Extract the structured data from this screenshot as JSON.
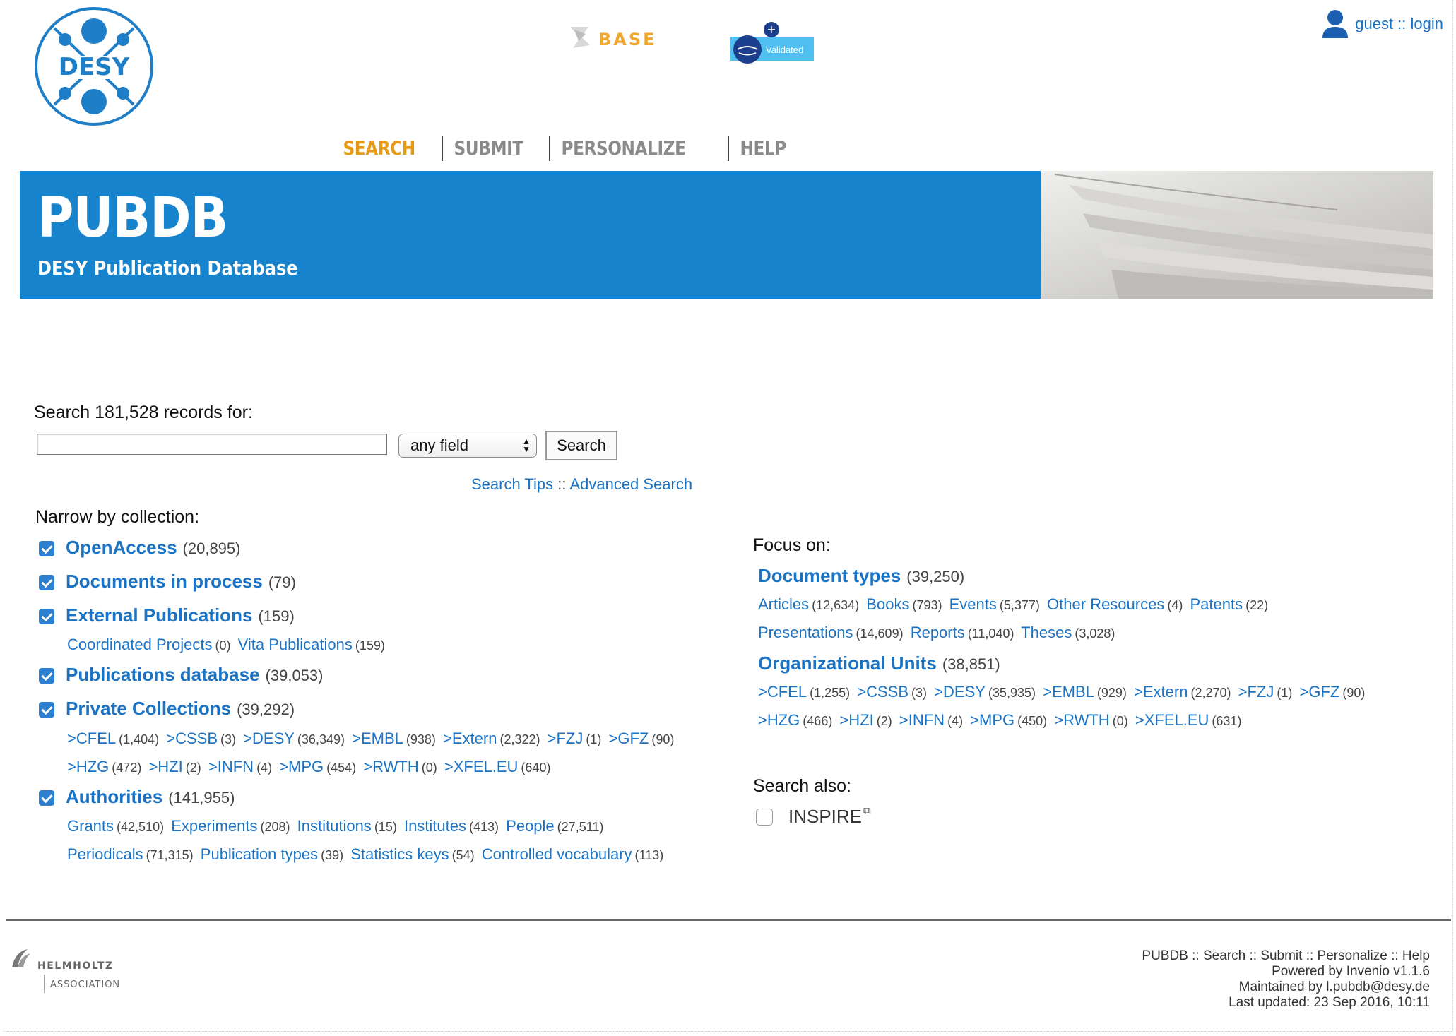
{
  "header": {
    "logo_text": "DESY",
    "base_logo_text": "BASE",
    "validated_text": "Validated",
    "user_label": "guest :: login"
  },
  "nav": {
    "items": [
      "SEARCH",
      "SUBMIT",
      "PERSONALIZE",
      "HELP"
    ],
    "active": "SEARCH"
  },
  "banner": {
    "title": "PUBDB",
    "subtitle": "DESY Publication Database"
  },
  "search": {
    "label": "Search 181,528 records for:",
    "query": "",
    "field_selected": "any field",
    "button": "Search",
    "tips": "Search Tips",
    "tips_sep": "::",
    "advanced": "Advanced Search"
  },
  "narrow": {
    "title": "Narrow by collection:",
    "collections": [
      {
        "name": "OpenAccess",
        "count": "(20,895)",
        "checked": true
      },
      {
        "name": "Documents in process",
        "count": "(79)",
        "checked": true
      },
      {
        "name": "External Publications",
        "count": "(159)",
        "checked": true
      },
      {
        "name": "Publications database",
        "count": "(39,053)",
        "checked": true
      },
      {
        "name": "Private Collections",
        "count": "(39,292)",
        "checked": true
      },
      {
        "name": "Authorities",
        "count": "(141,955)",
        "checked": true
      }
    ],
    "external_sub": [
      {
        "name": "Coordinated Projects",
        "count": "(0)"
      },
      {
        "name": "Vita Publications",
        "count": "(159)"
      }
    ],
    "private_sub_1": [
      {
        "name": ">CFEL",
        "count": "(1,404)"
      },
      {
        "name": ">CSSB",
        "count": "(3)"
      },
      {
        "name": ">DESY",
        "count": "(36,349)"
      },
      {
        "name": ">EMBL",
        "count": "(938)"
      },
      {
        "name": ">Extern",
        "count": "(2,322)"
      },
      {
        "name": ">FZJ",
        "count": "(1)"
      },
      {
        "name": ">GFZ",
        "count": "(90)"
      }
    ],
    "private_sub_2": [
      {
        "name": ">HZG",
        "count": "(472)"
      },
      {
        "name": ">HZI",
        "count": "(2)"
      },
      {
        "name": ">INFN",
        "count": "(4)"
      },
      {
        "name": ">MPG",
        "count": "(454)"
      },
      {
        "name": ">RWTH",
        "count": "(0)"
      },
      {
        "name": ">XFEL.EU",
        "count": "(640)"
      }
    ],
    "auth_sub_1": [
      {
        "name": "Grants",
        "count": "(42,510)"
      },
      {
        "name": "Experiments",
        "count": "(208)"
      },
      {
        "name": "Institutions",
        "count": "(15)"
      },
      {
        "name": "Institutes",
        "count": "(413)"
      },
      {
        "name": "People",
        "count": "(27,511)"
      }
    ],
    "auth_sub_2": [
      {
        "name": "Periodicals",
        "count": "(71,315)"
      },
      {
        "name": "Publication types",
        "count": "(39)"
      },
      {
        "name": "Statistics keys",
        "count": "(54)"
      },
      {
        "name": "Controlled vocabulary",
        "count": "(113)"
      }
    ]
  },
  "focus": {
    "title": "Focus on:",
    "doc_types": {
      "name": "Document types",
      "count": "(39,250)"
    },
    "doc_row_1": [
      {
        "name": "Articles",
        "count": "(12,634)"
      },
      {
        "name": "Books",
        "count": "(793)"
      },
      {
        "name": "Events",
        "count": "(5,377)"
      },
      {
        "name": "Other Resources",
        "count": "(4)"
      },
      {
        "name": "Patents",
        "count": "(22)"
      }
    ],
    "doc_row_2": [
      {
        "name": "Presentations",
        "count": "(14,609)"
      },
      {
        "name": "Reports",
        "count": "(11,040)"
      },
      {
        "name": "Theses",
        "count": "(3,028)"
      }
    ],
    "org_units": {
      "name": "Organizational Units",
      "count": "(38,851)"
    },
    "org_row_1": [
      {
        "name": ">CFEL",
        "count": "(1,255)"
      },
      {
        "name": ">CSSB",
        "count": "(3)"
      },
      {
        "name": ">DESY",
        "count": "(35,935)"
      },
      {
        "name": ">EMBL",
        "count": "(929)"
      },
      {
        "name": ">Extern",
        "count": "(2,270)"
      },
      {
        "name": ">FZJ",
        "count": "(1)"
      },
      {
        "name": ">GFZ",
        "count": "(90)"
      }
    ],
    "org_row_2": [
      {
        "name": ">HZG",
        "count": "(466)"
      },
      {
        "name": ">HZI",
        "count": "(2)"
      },
      {
        "name": ">INFN",
        "count": "(4)"
      },
      {
        "name": ">MPG",
        "count": "(450)"
      },
      {
        "name": ">RWTH",
        "count": "(0)"
      },
      {
        "name": ">XFEL.EU",
        "count": "(631)"
      }
    ],
    "also_title": "Search also:",
    "also_item": "INSPIRE"
  },
  "footer": {
    "helmholtz_line1": "HELMHOLTZ",
    "helmholtz_line2": "ASSOCIATION",
    "links": "PUBDB :: Search :: Submit :: Personalize :: Help",
    "powered": "Powered by Invenio v1.1.6",
    "maintained": "Maintained by l.pubdb@desy.de",
    "updated": "Last updated: 23 Sep 2016, 10:11"
  },
  "colors": {
    "link": "#1a73c5",
    "banner": "#1683cc",
    "nav_active": "#e69a17",
    "nav_inactive": "#8a8a8a",
    "desy_blue": "#1e7ec8"
  },
  "icons": [
    "desy-logo",
    "base-logo",
    "validated-badge-icon",
    "user-icon",
    "checkbox-checked",
    "checkbox-unchecked",
    "external-link-icon",
    "helmholtz-logo",
    "select-arrows-icon"
  ]
}
